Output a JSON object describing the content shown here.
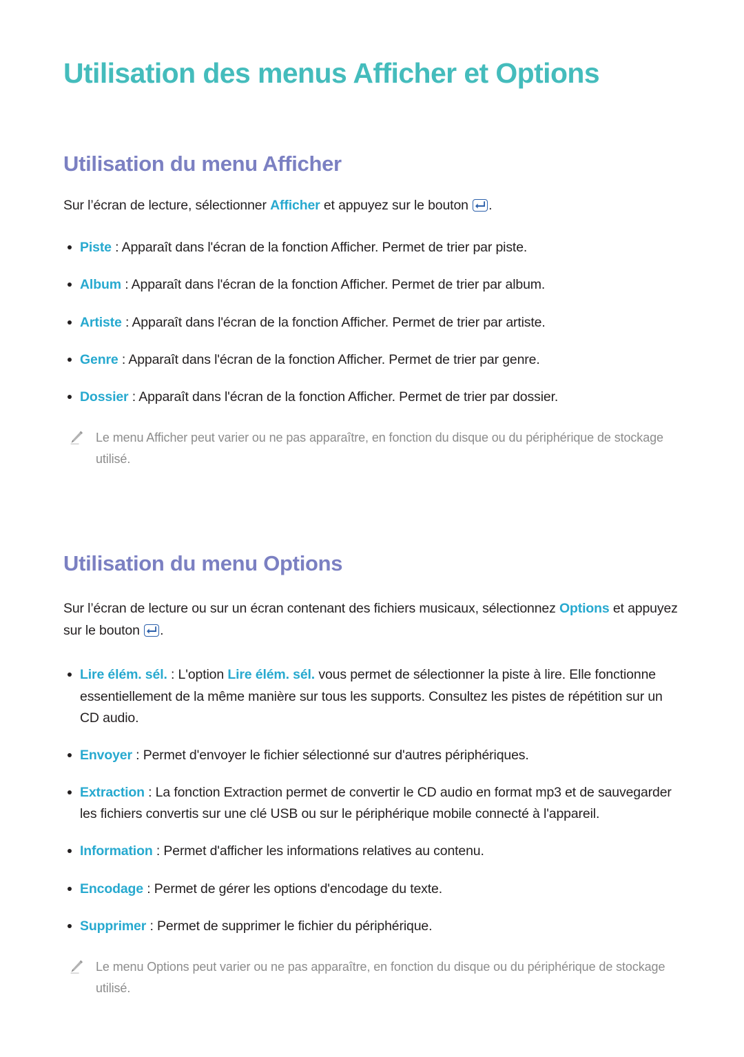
{
  "colors": {
    "title_teal": "#44bcbc",
    "heading_purple": "#7b80c2",
    "keyword_teal": "#27a9cf",
    "body_text": "#231f20",
    "note_gray": "#8c8c8c",
    "enter_key_blue": "#2b5faa"
  },
  "page_title": "Utilisation des menus Afficher et Options",
  "section_afficher": {
    "heading": "Utilisation du menu Afficher",
    "intro": {
      "before": "Sur l’écran de lecture, sélectionner ",
      "keyword": "Afficher",
      "after": " et appuyez sur le bouton ",
      "end": ".",
      "icon": "enter-key-icon"
    },
    "items": [
      {
        "term": "Piste",
        "text": " : Apparaît dans l'écran de la fonction Afficher. Permet de trier par piste."
      },
      {
        "term": "Album",
        "text": " : Apparaît dans l'écran de la fonction Afficher. Permet de trier par album."
      },
      {
        "term": "Artiste",
        "text": " : Apparaît dans l'écran de la fonction Afficher. Permet de trier par artiste."
      },
      {
        "term": "Genre",
        "text": " : Apparaît dans l'écran de la fonction Afficher. Permet de trier par genre."
      },
      {
        "term": "Dossier",
        "text": " : Apparaît dans l'écran de la fonction Afficher. Permet de trier par dossier."
      }
    ],
    "note": {
      "icon": "pencil-icon",
      "text": "Le menu Afficher peut varier ou ne pas apparaître, en fonction du disque ou du périphérique de stockage utilisé."
    }
  },
  "section_options": {
    "heading": "Utilisation du menu Options",
    "intro": {
      "before": "Sur l’écran de lecture ou sur un écran contenant des fichiers musicaux, sélectionnez ",
      "keyword": "Options",
      "after": " et appuyez sur le bouton ",
      "end": ".",
      "icon": "enter-key-icon"
    },
    "items": [
      {
        "term": "Lire élém. sél.",
        "text": " : L'option ",
        "term2": "Lire élém. sél.",
        "text2": " vous permet de sélectionner la piste à lire. Elle fonctionne essentiellement de la même manière sur tous les supports. Consultez les pistes de répétition sur un CD audio."
      },
      {
        "term": "Envoyer",
        "text": " : Permet d'envoyer le fichier sélectionné sur d'autres périphériques."
      },
      {
        "term": "Extraction",
        "text": " : La fonction Extraction permet de convertir le CD audio en format mp3 et de sauvegarder les fichiers convertis sur une clé USB ou sur le périphérique mobile connecté à l'appareil."
      },
      {
        "term": "Information",
        "text": " : Permet d'afficher les informations relatives au contenu."
      },
      {
        "term": "Encodage",
        "text": " : Permet de gérer les options d'encodage du texte."
      },
      {
        "term": "Supprimer",
        "text": " : Permet de supprimer le fichier du périphérique."
      }
    ],
    "note": {
      "icon": "pencil-icon",
      "text": "Le menu Options peut varier ou ne pas apparaître, en fonction du disque ou du périphérique de stockage utilisé."
    }
  }
}
